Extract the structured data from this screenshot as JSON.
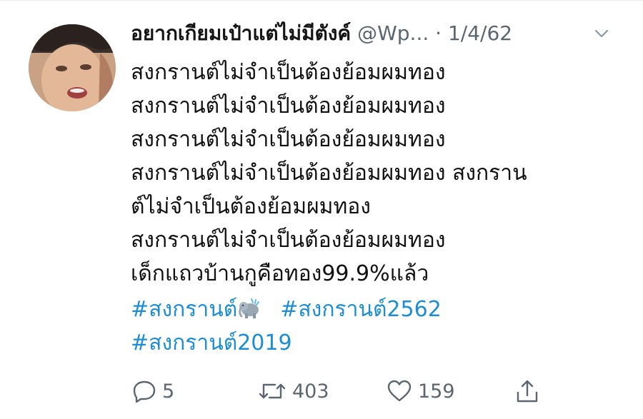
{
  "tweet": {
    "author": {
      "display_name": "อยากเกียมเป๋าแต่ไม่มีตังค์",
      "handle": "@Wp...",
      "separator": "·",
      "date": "1/4/62"
    },
    "text_lines": [
      "สงกรานต์ไม่จำเป็นต้องย้อมผมทอง",
      "สงกรานต์ไม่จำเป็นต้องย้อมผมทอง",
      "สงกรานต์ไม่จำเป็นต้องย้อมผมทอง",
      "สงกรานต์ไม่จำเป็นต้องย้อมผมทอง  สงกราน",
      "ต์ไม่จำเป็นต้องย้อมผมทอง",
      "สงกรานต์ไม่จำเป็นต้องย้อมผมทอง",
      "เด็กแถวบ้านกูคือทอง99.9%แล้ว"
    ],
    "hashtags": [
      "#สงกรานต์",
      "#สงกรานต์2562",
      "#สงกรานต์2019"
    ],
    "emoji": "elephant",
    "actions": {
      "reply_count": "5",
      "retweet_count": "403",
      "like_count": "159"
    }
  },
  "colors": {
    "link": "#1d8ed6",
    "muted": "#5b6670",
    "text": "#111111"
  },
  "icons": [
    "chevron-down-icon",
    "reply-icon",
    "retweet-icon",
    "like-icon",
    "share-icon"
  ]
}
